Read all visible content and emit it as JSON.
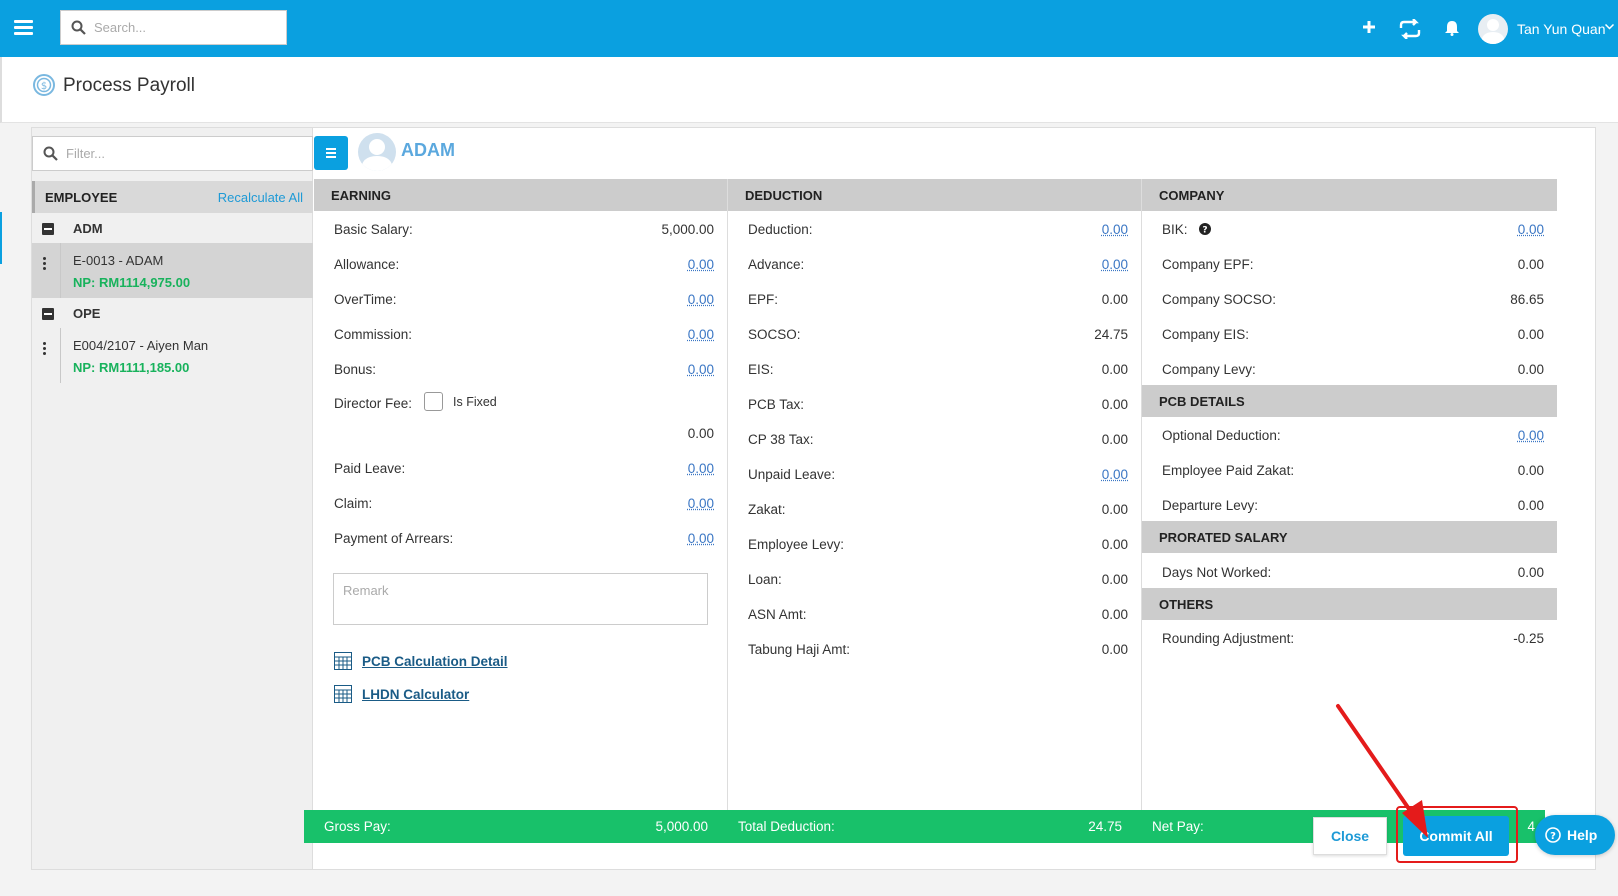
{
  "topbar": {
    "search_placeholder": "Search...",
    "user_name": "Tan Yun Quan",
    "icons": [
      "menu-icon",
      "search-icon",
      "plus-icon",
      "sync-icon",
      "bell-icon",
      "user-avatar-icon",
      "chevron-down-icon"
    ]
  },
  "page": {
    "title": "Process Payroll"
  },
  "sidebar": {
    "filter_placeholder": "Filter...",
    "header_label": "EMPLOYEE",
    "recalculate_label": "Recalculate All",
    "groups": [
      {
        "name": "ADM",
        "employees": [
          {
            "name": "E-0013 - ADAM",
            "net_pay": "NP: RM1114,975.00",
            "active": true
          }
        ]
      },
      {
        "name": "OPE",
        "employees": [
          {
            "name": "E004/2107 - Aiyen Man",
            "net_pay": "NP: RM1111,185.00",
            "active": false
          }
        ]
      }
    ]
  },
  "employee": {
    "title": "ADAM"
  },
  "earning": {
    "header": "EARNING",
    "rows": [
      {
        "label": "Basic Salary:",
        "value": "5,000.00"
      },
      {
        "label": "Allowance:",
        "value": "0.00"
      },
      {
        "label": "OverTime:",
        "value": "0.00"
      },
      {
        "label": "Commission:",
        "value": "0.00"
      },
      {
        "label": "Bonus:",
        "value": "0.00"
      },
      {
        "label": "Director Fee:",
        "value": "0.00"
      },
      {
        "label": "Paid Leave:",
        "value": "0.00"
      },
      {
        "label": "Claim:",
        "value": "0.00"
      },
      {
        "label": "Payment of Arrears:",
        "value": "0.00"
      }
    ],
    "is_fixed_label": "Is Fixed",
    "remark_placeholder": "Remark",
    "pcb_link": "PCB Calculation Detail",
    "lhdn_link": "LHDN Calculator",
    "footer_label": "Gross Pay:",
    "footer_value": "5,000.00"
  },
  "deduction": {
    "header": "DEDUCTION",
    "rows": [
      {
        "label": "Deduction:",
        "value": "0.00"
      },
      {
        "label": "Advance:",
        "value": "0.00"
      },
      {
        "label": "EPF:",
        "value": "0.00"
      },
      {
        "label": "SOCSO:",
        "value": "24.75"
      },
      {
        "label": "EIS:",
        "value": "0.00"
      },
      {
        "label": "PCB Tax:",
        "value": "0.00"
      },
      {
        "label": "CP 38 Tax:",
        "value": "0.00"
      },
      {
        "label": "Unpaid Leave:",
        "value": "0.00"
      },
      {
        "label": "Zakat:",
        "value": "0.00"
      },
      {
        "label": "Employee Levy:",
        "value": "0.00"
      },
      {
        "label": "Loan:",
        "value": "0.00"
      },
      {
        "label": "ASN Amt:",
        "value": "0.00"
      },
      {
        "label": "Tabung Haji Amt:",
        "value": "0.00"
      }
    ],
    "footer_label": "Total Deduction:",
    "footer_value": "24.75"
  },
  "company": {
    "header": "COMPANY",
    "rows": [
      {
        "label": "BIK:",
        "value": "0.00"
      },
      {
        "label": "Company EPF:",
        "value": "0.00"
      },
      {
        "label": "Company SOCSO:",
        "value": "86.65"
      },
      {
        "label": "Company EIS:",
        "value": "0.00"
      },
      {
        "label": "Company Levy:",
        "value": "0.00"
      }
    ],
    "pcb_header": "PCB DETAILS",
    "pcb_rows": [
      {
        "label": "Optional Deduction:",
        "value": "0.00"
      },
      {
        "label": "Employee Paid Zakat:",
        "value": "0.00"
      },
      {
        "label": "Departure Levy:",
        "value": "0.00"
      }
    ],
    "prorated_header": "PRORATED SALARY",
    "prorated_rows": [
      {
        "label": "Days Not Worked:",
        "value": "0.00"
      }
    ],
    "others_header": "OTHERS",
    "others_rows": [
      {
        "label": "Rounding Adjustment:",
        "value": "-0.25"
      }
    ],
    "footer_label": "Net Pay:",
    "footer_value_partial": "4"
  },
  "actions": {
    "close_label": "Close",
    "commit_label": "Commit All",
    "help_label": "Help"
  },
  "colors": {
    "brand": "#0aa0e0",
    "footer_green": "#18c16a",
    "net_pay_green": "#18b25c",
    "highlight_red": "#e41b1b"
  }
}
